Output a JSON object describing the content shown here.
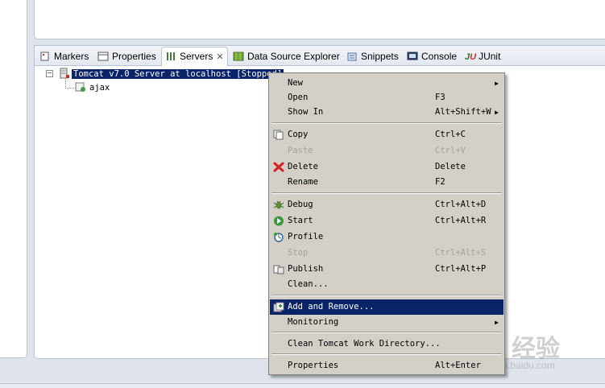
{
  "tabs": [
    {
      "label": "Markers",
      "icon": "markers-icon"
    },
    {
      "label": "Properties",
      "icon": "properties-icon"
    },
    {
      "label": "Servers",
      "icon": "servers-icon",
      "active": true
    },
    {
      "label": "Data Source Explorer",
      "icon": "data-source-icon"
    },
    {
      "label": "Snippets",
      "icon": "snippets-icon"
    },
    {
      "label": "Console",
      "icon": "console-icon"
    },
    {
      "label": "JUnit",
      "icon": "junit-icon"
    }
  ],
  "tree": {
    "server_label": "Tomcat v7.0 Server at localhost  [Stopped]",
    "child_label": "ajax"
  },
  "menu": {
    "new": {
      "label": "New"
    },
    "open": {
      "label": "Open",
      "accel": "F3"
    },
    "show_in": {
      "label": "Show In",
      "accel": "Alt+Shift+W"
    },
    "copy": {
      "label": "Copy",
      "accel": "Ctrl+C"
    },
    "paste": {
      "label": "Paste",
      "accel": "Ctrl+V"
    },
    "delete": {
      "label": "Delete",
      "accel": "Delete"
    },
    "rename": {
      "label": "Rename",
      "accel": "F2"
    },
    "debug": {
      "label": "Debug",
      "accel": "Ctrl+Alt+D"
    },
    "start": {
      "label": "Start",
      "accel": "Ctrl+Alt+R"
    },
    "profile": {
      "label": "Profile"
    },
    "stop": {
      "label": "Stop",
      "accel": "Ctrl+Alt+S"
    },
    "publish": {
      "label": "Publish",
      "accel": "Ctrl+Alt+P"
    },
    "clean": {
      "label": "Clean..."
    },
    "add_remove": {
      "label": "Add and Remove..."
    },
    "monitoring": {
      "label": "Monitoring"
    },
    "clean_work_dir": {
      "label": "Clean Tomcat Work Directory..."
    },
    "properties": {
      "label": "Properties",
      "accel": "Alt+Enter"
    }
  },
  "watermark": {
    "brand": "Bai 经验",
    "url": "jingyan.baidu.com"
  },
  "colors": {
    "selection": "#0a246a",
    "menu_bg": "#d4d0c8",
    "tab_border": "#b9c3d3"
  }
}
